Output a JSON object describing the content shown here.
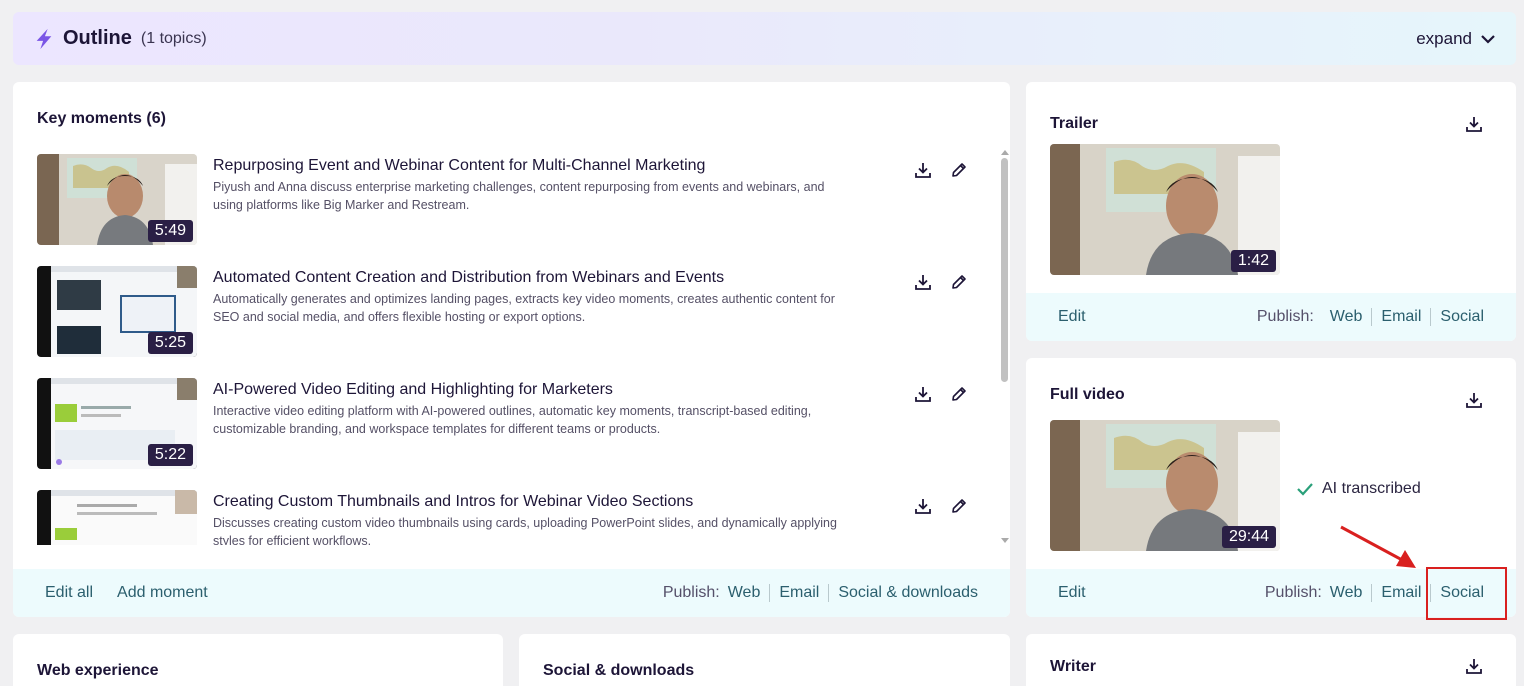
{
  "outline": {
    "title": "Outline",
    "count": "(1 topics)",
    "expand_label": "expand"
  },
  "key_moments": {
    "title": "Key moments (6)",
    "items": [
      {
        "title": "Repurposing Event and Webinar Content for Multi-Channel Marketing",
        "description": "Piyush and Anna discuss enterprise marketing challenges, content repurposing from events and webinars, and using platforms like Big Marker and Restream.",
        "duration": "5:49"
      },
      {
        "title": "Automated Content Creation and Distribution from Webinars and Events",
        "description": "Automatically generates and optimizes landing pages, extracts key video moments, creates authentic content for SEO and social media, and offers flexible hosting or export options.",
        "duration": "5:25"
      },
      {
        "title": "AI-Powered Video Editing and Highlighting for Marketers",
        "description": "Interactive video editing platform with AI-powered outlines, automatic key moments, transcript-based editing, customizable branding, and workspace templates for different teams or products.",
        "duration": "5:22"
      },
      {
        "title": "Creating Custom Thumbnails and Intros for Webinar Video Sections",
        "description": "Discusses creating custom video thumbnails using cards, uploading PowerPoint slides, and dynamically applying styles for efficient workflows.",
        "duration": ""
      }
    ],
    "footer": {
      "edit_all": "Edit all",
      "add_moment": "Add moment",
      "publish_label": "Publish:",
      "web": "Web",
      "email": "Email",
      "social_downloads": "Social & downloads"
    }
  },
  "trailer": {
    "title": "Trailer",
    "duration": "1:42",
    "footer": {
      "edit": "Edit",
      "publish_label": "Publish:",
      "web": "Web",
      "email": "Email",
      "social": "Social"
    }
  },
  "full_video": {
    "title": "Full video",
    "duration": "29:44",
    "ai_status": "AI transcribed",
    "footer": {
      "edit": "Edit",
      "publish_label": "Publish:",
      "web": "Web",
      "email": "Email",
      "social": "Social"
    }
  },
  "bottom_cards": {
    "web_experience": "Web experience",
    "social_downloads": "Social & downloads",
    "writer": "Writer"
  },
  "colors": {
    "accent": "#2b5f6e",
    "footer_bg": "#edfbfd",
    "highlight": "#d9201f",
    "duration_bg": "#2a1f45"
  }
}
